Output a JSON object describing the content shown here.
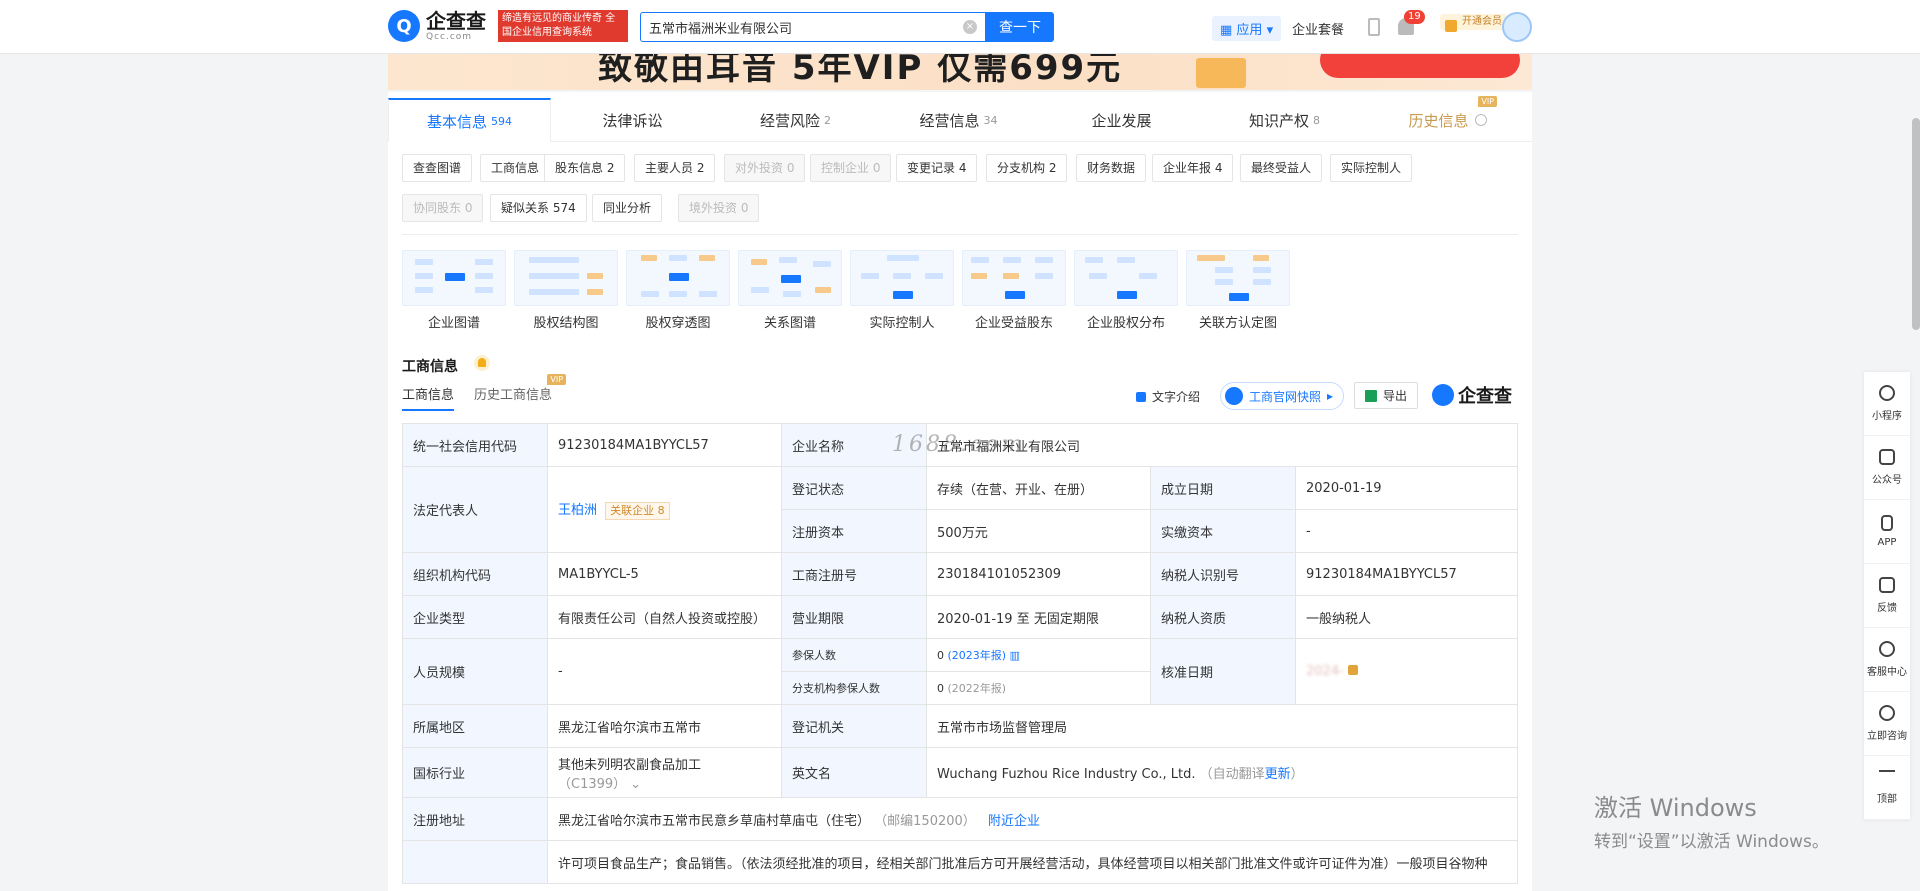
{
  "header": {
    "logo_cn": "企查查",
    "logo_en": "Qcc.com",
    "slogan": "缔造有远见的商业传奇 全国企业信用查询系统",
    "search_value": "五常市福洲米业有限公司",
    "search_button": "查一下",
    "apps_label": "应用",
    "package_label": "企业套餐",
    "notification_count": "19",
    "vip_label": "开通会员"
  },
  "banner": {
    "text": "致敬由耳音 5年VIP 仅需699元"
  },
  "tabs": [
    {
      "label": "基本信息",
      "count": "594"
    },
    {
      "label": "法律诉讼",
      "count": ""
    },
    {
      "label": "经营风险",
      "count": "2"
    },
    {
      "label": "经营信息",
      "count": "34"
    },
    {
      "label": "企业发展",
      "count": ""
    },
    {
      "label": "知识产权",
      "count": "8"
    },
    {
      "label": "历史信息",
      "count": "",
      "vip": "VIP"
    }
  ],
  "chips": [
    "查查图谱",
    "工商信息",
    "股东信息 2",
    "主要人员 2",
    "对外投资 0",
    "控制企业 0",
    "变更记录 4",
    "分支机构 2",
    "财务数据",
    "企业年报 4",
    "最终受益人",
    "实际控制人",
    "协同股东 0",
    "疑似关系 574",
    "同业分析",
    "境外投资 0"
  ],
  "graphs": [
    "企业图谱",
    "股权结构图",
    "股权穿透图",
    "关系图谱",
    "实际控制人",
    "企业受益股东",
    "企业股权分布",
    "关联方认定图"
  ],
  "section": {
    "title": "工商信息",
    "subtab_active": "工商信息",
    "subtab_history": "历史工商信息",
    "subtab_vip": "VIP",
    "tool_text": "文字介绍",
    "tool_snapshot": "工商官网快照",
    "tool_export": "导出",
    "brand": "企查查"
  },
  "info": {
    "credit_code_k": "统一社会信用代码",
    "credit_code_v": "91230184MA1BYYCL57",
    "name_k": "企业名称",
    "name_v": "五常市福洲米业有限公司",
    "legal_k": "法定代表人",
    "legal_v": "王柏洲",
    "legal_rel": "关联企业 8",
    "status_k": "登记状态",
    "status_v": "存续（在营、开业、在册）",
    "found_k": "成立日期",
    "found_v": "2020-01-19",
    "capital_k": "注册资本",
    "capital_v": "500万元",
    "paid_k": "实缴资本",
    "paid_v": "-",
    "org_k": "组织机构代码",
    "org_v": "MA1BYYCL-5",
    "reg_no_k": "工商注册号",
    "reg_no_v": "230184101052309",
    "tax_id_k": "纳税人识别号",
    "tax_id_v": "91230184MA1BYYCL57",
    "type_k": "企业类型",
    "type_v": "有限责任公司（自然人投资或控股）",
    "term_k": "营业期限",
    "term_v": "2020-01-19 至 无固定期限",
    "tax_q_k": "纳税人资质",
    "tax_q_v": "一般纳税人",
    "scale_k": "人员规模",
    "scale_v": "-",
    "insured_k": "参保人数",
    "insured_v": "0",
    "insured_year": "(2023年报)",
    "branch_insured_k": "分支机构参保人数",
    "branch_insured_v": "0",
    "branch_insured_year": "(2022年报)",
    "approve_k": "核准日期",
    "approve_v": "2024-",
    "region_k": "所属地区",
    "region_v": "黑龙江省哈尔滨市五常市",
    "authority_k": "登记机关",
    "authority_v": "五常市市场监督管理局",
    "industry_k": "国标行业",
    "industry_v": "其他未列明农副食品加工",
    "industry_code": "（C1399）",
    "en_k": "英文名",
    "en_v": "Wuchang Fuzhou Rice Industry Co., Ltd.",
    "en_auto": "（自动翻译",
    "en_update": "更新",
    "en_close": "）",
    "addr_k": "注册地址",
    "addr_v": "黑龙江省哈尔滨市五常市民意乡草庙村草庙屯（住宅）",
    "addr_zip": "（邮编150200）",
    "addr_nearby": "附近企业",
    "scope_v": "许可项目食品生产；食品销售。（依法须经批准的项目，经相关部门批准后方可开展经营活动，具体经营项目以相关部门批准文件或许可证件为准）一般项目谷物种"
  },
  "watermark": "1688.com",
  "sidebar": [
    "小程序",
    "公众号",
    "APP",
    "反馈",
    "客服中心",
    "立即咨询",
    "顶部"
  ],
  "windows": {
    "line1": "激活 Windows",
    "line2": "转到“设置”以激活 Windows。"
  }
}
